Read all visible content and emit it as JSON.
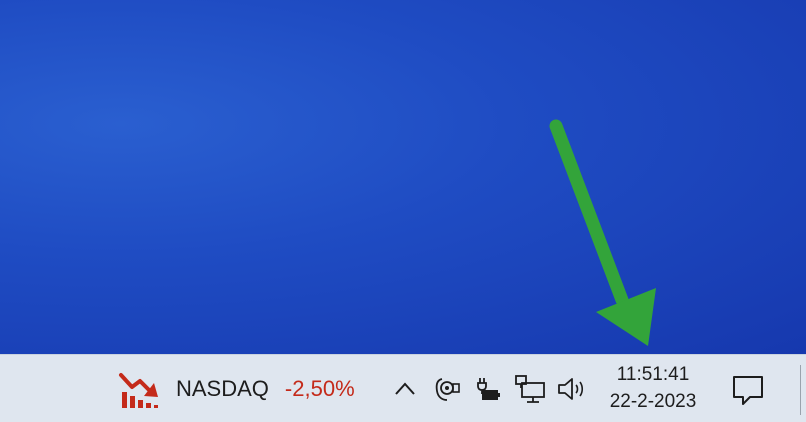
{
  "colors": {
    "desktop_blue": "#1f4cc3",
    "arrow_green": "#33a43a",
    "taskbar_bg": "#dfe6ef",
    "negative_red": "#c42a1a"
  },
  "widget": {
    "icon": "stock-down-icon",
    "name": "NASDAQ",
    "change": "-2,50%"
  },
  "tray": {
    "icons": [
      "chevron-up-icon",
      "camera-icon",
      "battery-icon",
      "network-icon",
      "volume-icon"
    ]
  },
  "clock": {
    "time": "11:51:41",
    "date": "22-2-2023"
  },
  "notifications": {
    "icon": "notification-icon"
  }
}
